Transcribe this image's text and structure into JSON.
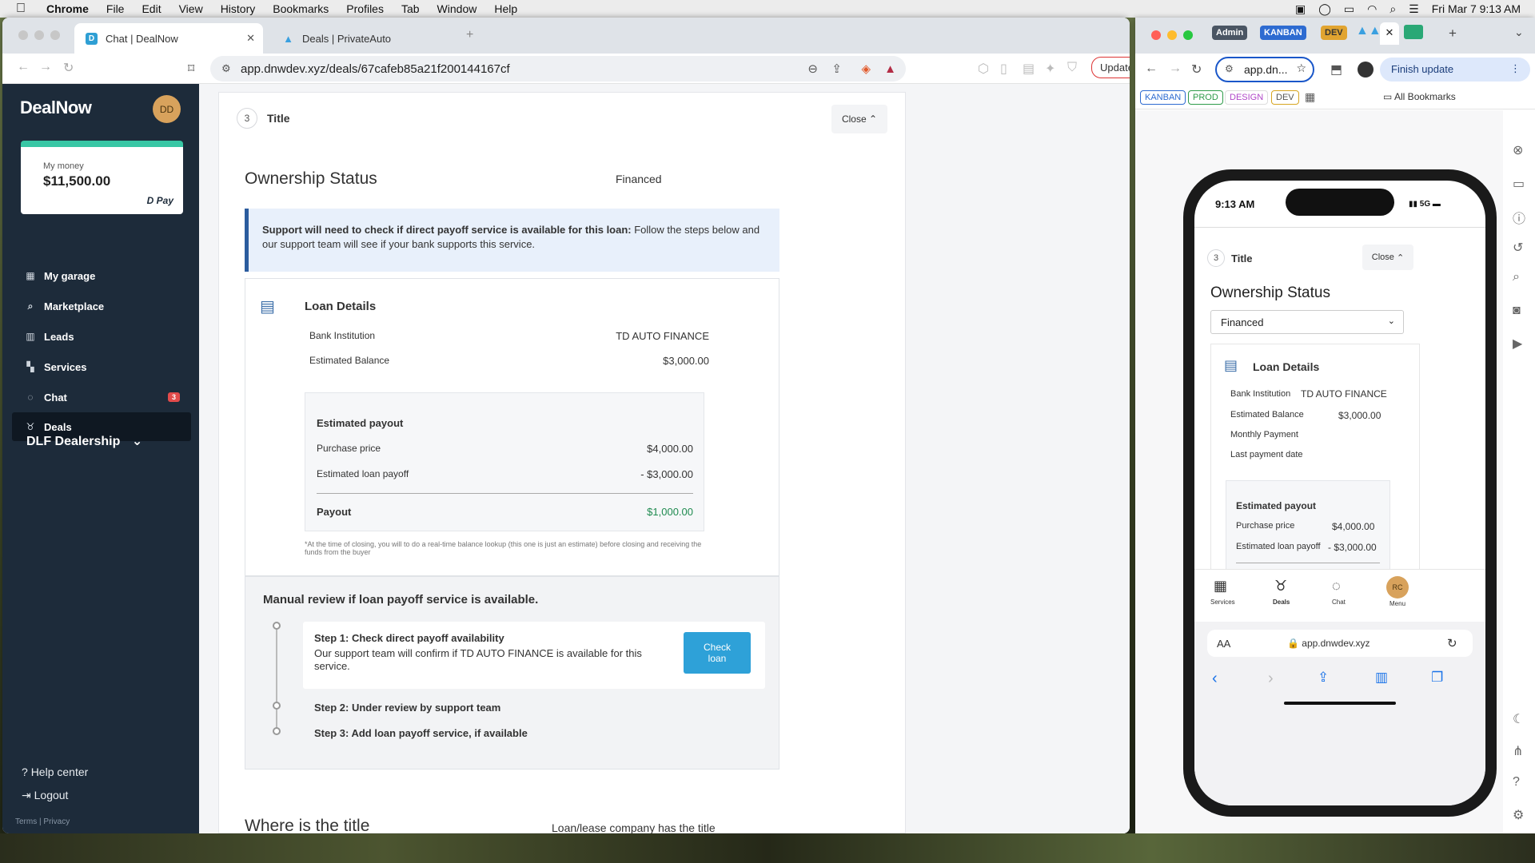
{
  "menubar": {
    "apple": "",
    "app": "Chrome",
    "items": [
      "File",
      "Edit",
      "View",
      "History",
      "Bookmarks",
      "Profiles",
      "Tab",
      "Window",
      "Help"
    ],
    "datetime": "Fri Mar 7  9:13 AM"
  },
  "browser1": {
    "tabs": [
      {
        "title": "Chat | DealNow",
        "favicon": "D",
        "favicon_color": "#2f9fd4"
      },
      {
        "title": "Deals | PrivateAuto",
        "favicon": "▲",
        "favicon_color": "#3aa0e0"
      }
    ],
    "new_tab": "+",
    "url": "app.dnwdev.xyz/deals/67cafeb85a21f200144167cf",
    "update_label": "Update"
  },
  "sidebar": {
    "logo": "DealNow",
    "avatar_initials": "DD",
    "money_label": "My money",
    "money_amount": "$11,500.00",
    "pay_label": "Pay",
    "nav": [
      {
        "label": "My garage",
        "icon": "garage-icon"
      },
      {
        "label": "Marketplace",
        "icon": "search-icon"
      },
      {
        "label": "Leads",
        "icon": "leads-icon"
      },
      {
        "label": "Services",
        "icon": "grid-icon"
      },
      {
        "label": "Chat",
        "icon": "chat-icon",
        "badge": "3"
      },
      {
        "label": "Deals",
        "icon": "ribbon-icon",
        "active": true
      }
    ],
    "dealership": "DLF Dealership",
    "help": "Help center",
    "logout": "Logout",
    "terms": "Terms",
    "sep": "|",
    "privacy": "Privacy"
  },
  "main": {
    "step_number": "3",
    "step_title": "Title",
    "close_label": "Close",
    "ownership_label": "Ownership Status",
    "ownership_value": "Financed",
    "alert_bold": "Support will need to check if direct payoff service is available for this loan:",
    "alert_text": " Follow the steps below and our support team will see if your bank supports this service.",
    "loan_title": "Loan Details",
    "bank_label": "Bank Institution",
    "bank_value": "TD AUTO FINANCE",
    "balance_label": "Estimated Balance",
    "balance_value": "$3,000.00",
    "est_title": "Estimated payout",
    "purchase_label": "Purchase price",
    "purchase_value": "$4,000.00",
    "payoff_label": "Estimated loan payoff",
    "payoff_value": "- $3,000.00",
    "payout_label": "Payout",
    "payout_value": "$1,000.00",
    "footnote": "*At the time of closing, you will to do a real-time balance lookup (this one is just an estimate) before closing and receiving the funds from the buyer",
    "manual_title": "Manual review if loan payoff service is available.",
    "step1_title": "Step 1: Check direct payoff availability",
    "step1_text": "Our support team will confirm if TD AUTO FINANCE is available for this service.",
    "check_btn": "Check loan",
    "step2": "Step 2: Under review by support team",
    "step3": "Step 3: Add loan payoff service, if available",
    "where_label": "Where is the title",
    "where_value": "Loan/lease company has the title"
  },
  "browser2": {
    "tab_pills": [
      {
        "label": "Admin",
        "color": "#4a5563"
      },
      {
        "label": "KANBAN",
        "color": "#2d6bd1"
      },
      {
        "label": "DEV",
        "color": "#e1a430"
      }
    ],
    "url": "app.dn...",
    "finish_update": "Finish update",
    "bookmarks": [
      {
        "label": "KANBAN",
        "color": "#2d6bd1"
      },
      {
        "label": "PROD",
        "color": "#2f9b4a"
      },
      {
        "label": "DESIGN",
        "color": "#b046c8"
      },
      {
        "label": "DEV",
        "color": "#d7a521"
      }
    ],
    "all_bookmarks": "All Bookmarks"
  },
  "phone": {
    "time": "9:13 AM",
    "signal": "5G",
    "step_number": "3",
    "step_title": "Title",
    "close_label": "Close",
    "ownership_label": "Ownership Status",
    "ownership_value": "Financed",
    "loan_title": "Loan Details",
    "bank_label": "Bank Institution",
    "bank_value": "TD AUTO FINANCE",
    "balance_label": "Estimated Balance",
    "balance_value": "$3,000.00",
    "monthly_label": "Monthly Payment",
    "lastpay_label": "Last payment date",
    "est_title": "Estimated payout",
    "purchase_label": "Purchase price",
    "purchase_value": "$4,000.00",
    "payoff_label": "Estimated loan payoff",
    "payoff_value": "- $3,000.00",
    "tabs": [
      "Services",
      "Deals",
      "Chat",
      "Menu"
    ],
    "menu_initials": "RC",
    "aa": "AA",
    "url": "app.dnwdev.xyz"
  }
}
